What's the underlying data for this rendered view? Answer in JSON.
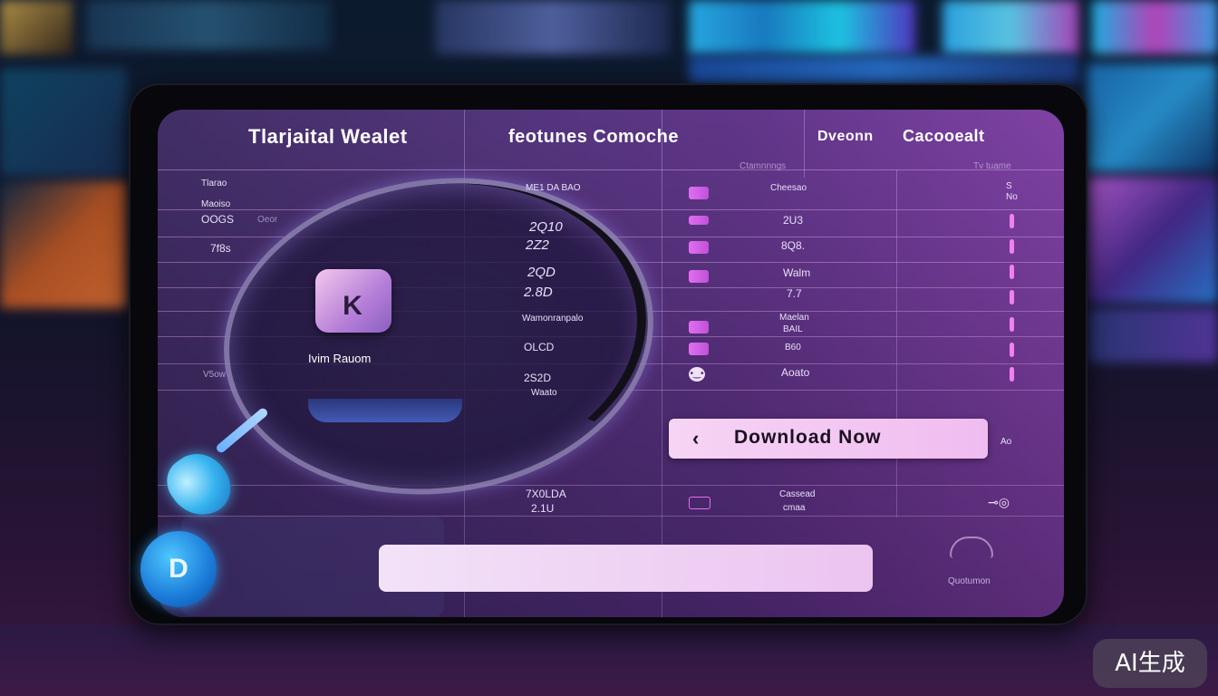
{
  "header": {
    "col1": "Tlarjaital Wealet",
    "col2": "feotunes  Comoche",
    "col3": "Dveonn",
    "col4": "Cacooealt",
    "sub2": "Ctamnnngs",
    "sub4": "Tv tuame"
  },
  "left_labels": [
    "Tlarao",
    "Maoiso",
    "OOGS",
    "7f8s"
  ],
  "left_extra": "Oeor",
  "left_bottom": "V5ow",
  "mid_column": [
    "ME1 DA BAO",
    "2Q10",
    "2Z2",
    "2QD",
    "2.8D",
    "Wamonranpalo",
    "OLCD",
    "2S2D"
  ],
  "mid_extra": "Waato",
  "mid_bottom": [
    "7X0LDA",
    "2.1U"
  ],
  "right_column": [
    "Cheesao",
    "2U3",
    "8Q8.",
    "Walm",
    "7.7",
    "Maelan",
    "BAIL",
    "B60",
    "Aoato"
  ],
  "right_bottom": [
    "Cassead",
    "cmaa"
  ],
  "right_edge": "S",
  "right_edge_sub": "No",
  "right_side_small": "Ao",
  "lens": {
    "label": "Ivim Rauom",
    "tile_glyph": "K"
  },
  "logo_glyph": "D",
  "download": {
    "chevron": "‹",
    "label": "Download Now"
  },
  "bottom": {
    "cloud_label": "Quotumon"
  },
  "badge": "AI生成",
  "colors": {
    "accent": "#f0bcf0",
    "screen": "#5a2e84",
    "logo": "#1a7ad8"
  }
}
